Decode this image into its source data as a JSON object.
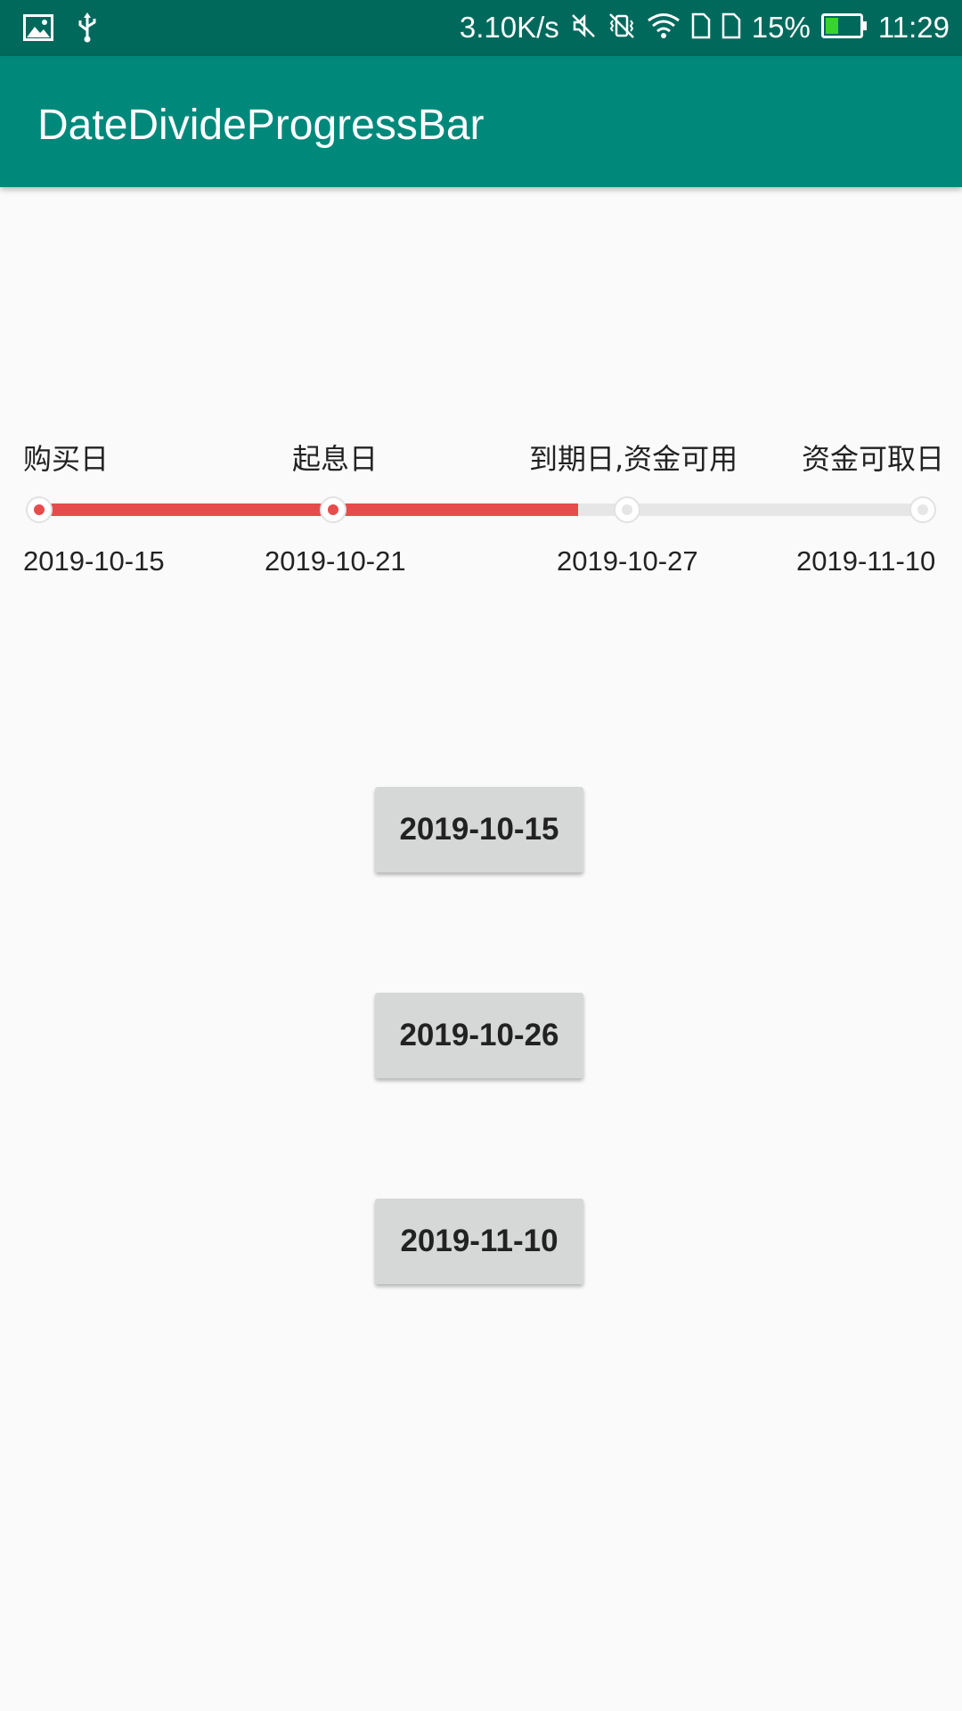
{
  "status_bar": {
    "net_speed": "3.10K/s",
    "battery_percent": "15%",
    "battery_level": 0.15,
    "time": "11:29",
    "icons_left": [
      "image-icon",
      "usb-icon"
    ],
    "icons_right": [
      "mute-icon",
      "vibrate-off-icon",
      "wifi-icon",
      "sim1-icon",
      "sim2-icon",
      "battery-icon"
    ]
  },
  "app_bar": {
    "title": "DateDivideProgressBar"
  },
  "progress": {
    "fill_fraction": 0.61,
    "fill_color": "#e74c4c",
    "track_color": "#e6e6e6",
    "milestones": [
      {
        "label": "购买日",
        "date": "2019-10-15",
        "reached": true
      },
      {
        "label": "起息日",
        "date": "2019-10-21",
        "reached": true
      },
      {
        "label": "到期日,资金可用",
        "date": "2019-10-27",
        "reached": false
      },
      {
        "label": "资金可取日",
        "date": "2019-11-10",
        "reached": false
      }
    ]
  },
  "buttons": [
    {
      "label": "2019-10-15"
    },
    {
      "label": "2019-10-26"
    },
    {
      "label": "2019-11-10"
    }
  ]
}
